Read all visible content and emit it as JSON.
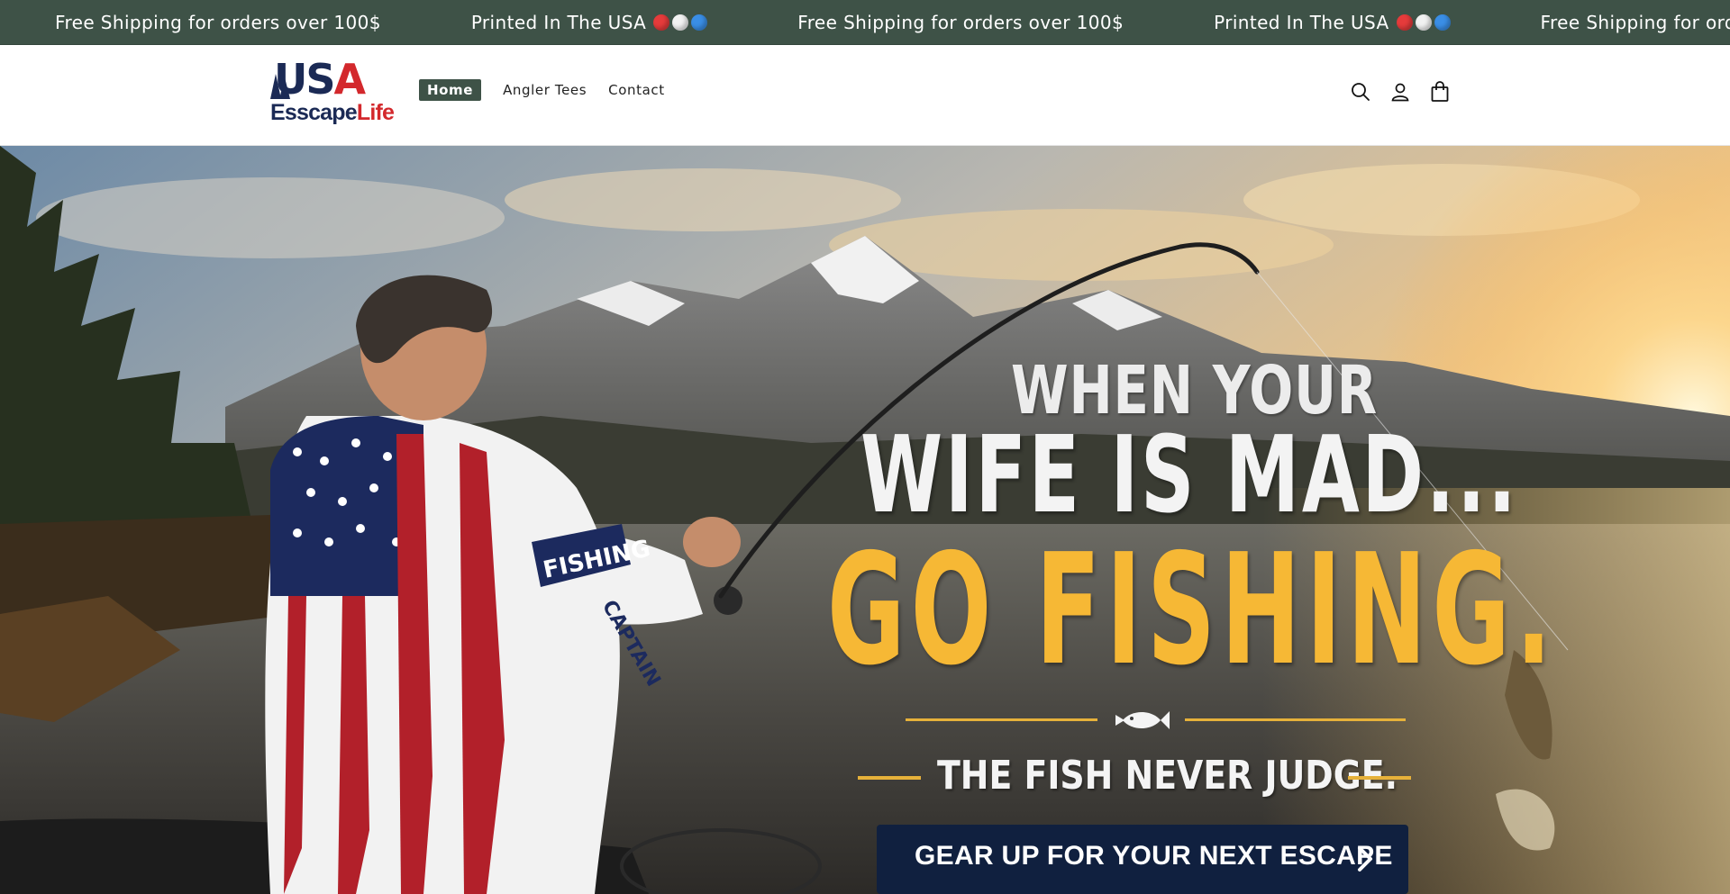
{
  "announcement": {
    "items": [
      {
        "text": "Free Shipping for orders over 100$",
        "has_flag_dots": false
      },
      {
        "text": "Printed In The USA",
        "has_flag_dots": true
      },
      {
        "text": "Free Shipping for orders over 100$",
        "has_flag_dots": false
      },
      {
        "text": "Printed In The USA",
        "has_flag_dots": true
      },
      {
        "text": "Free Shipping for orders over 100$",
        "has_flag_dots": false
      }
    ],
    "background_color": "#3e5247",
    "flag_dot_colors": [
      "#e53b3b",
      "#f2f2f2",
      "#3a8ee6"
    ]
  },
  "header": {
    "logo": {
      "line1_u": "U",
      "line1_s": "S",
      "line1_a": "A",
      "word_part1": "Esscape",
      "word_part2": "Life"
    },
    "nav": [
      {
        "label": "Home",
        "active": true
      },
      {
        "label": "Angler Tees",
        "active": false
      },
      {
        "label": "Contact",
        "active": false
      }
    ],
    "icons": [
      "search-icon",
      "account-icon",
      "cart-icon"
    ]
  },
  "hero": {
    "line1": "WHEN YOUR",
    "line2": "WIFE IS MAD...",
    "line3": "GO FISHING.",
    "tagline": "THE FISH NEVER JUDGE.",
    "cta_label": "GEAR UP FOR YOUR NEXT ESCAPE",
    "sleeve_text": "FISHING",
    "sleeve_text_2": "CAPTAIN",
    "accent_color": "#f6b835",
    "cta_color": "#10203f"
  }
}
